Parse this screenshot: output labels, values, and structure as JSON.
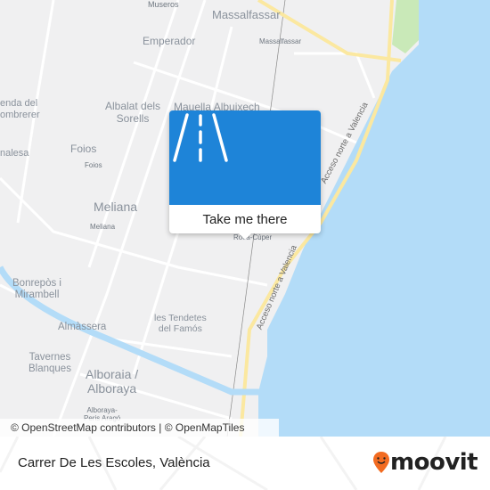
{
  "map": {
    "colors": {
      "land": "#f0f0f1",
      "water": "#b3dcf8",
      "highway": "#fbe8a0",
      "park": "#c9e9b8",
      "popup": "#1e84d8",
      "brand": "#f26b21"
    },
    "places": [
      {
        "name": "Museros"
      },
      {
        "name": "Massalfassar"
      },
      {
        "name": "Emperador"
      },
      {
        "name": "Massalfassar"
      },
      {
        "name": "enda del\nombrerer"
      },
      {
        "name": "Albalat dels\nSorells"
      },
      {
        "name": "Mauella Albuixech"
      },
      {
        "name": "Foios"
      },
      {
        "name": "Foios"
      },
      {
        "name": "nalesa"
      },
      {
        "name": "Meliana"
      },
      {
        "name": "Meliana"
      },
      {
        "name": "Roca-Cúper"
      },
      {
        "name": "Bonrepòs i\nMirambell"
      },
      {
        "name": "Almàssera"
      },
      {
        "name": "les Tendetes\ndel Famós"
      },
      {
        "name": "Tavernes\nBlanques"
      },
      {
        "name": "Alboraia /\nAlboraya"
      },
      {
        "name": "Alboraya-\nPeris Aragó"
      }
    ],
    "roads": [
      {
        "name": "Acceso norte a Valencia"
      },
      {
        "name": "Acceso norte a Valencia"
      }
    ],
    "attribution": "© OpenStreetMap contributors | © OpenMapTiles"
  },
  "popup": {
    "icon": "road-icon",
    "button_label": "Take me there"
  },
  "footer": {
    "address": "Carrer De Les Escoles, València",
    "logo_text": "moovit"
  }
}
